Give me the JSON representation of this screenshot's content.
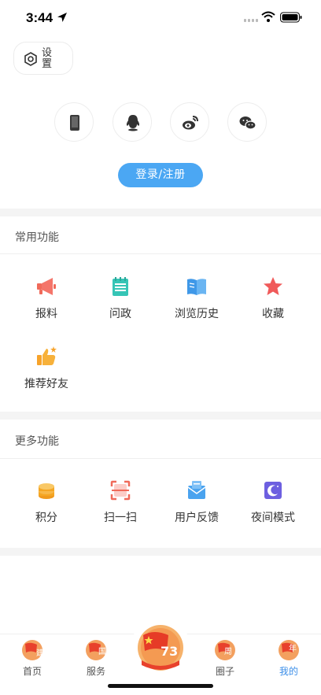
{
  "status_bar": {
    "time": "3:44"
  },
  "header": {
    "settings_label": "设置",
    "login_methods": [
      "phone",
      "qq",
      "weibo",
      "wechat"
    ],
    "login_button": "登录/注册"
  },
  "common_functions": {
    "title": "常用功能",
    "items": [
      {
        "label": "报料",
        "icon": "megaphone-icon"
      },
      {
        "label": "问政",
        "icon": "notepad-icon"
      },
      {
        "label": "浏览历史",
        "icon": "book-icon"
      },
      {
        "label": "收藏",
        "icon": "star-icon"
      },
      {
        "label": "推荐好友",
        "icon": "thumbs-up-icon"
      }
    ]
  },
  "more_functions": {
    "title": "更多功能",
    "items": [
      {
        "label": "积分",
        "icon": "coins-icon"
      },
      {
        "label": "扫一扫",
        "icon": "scan-icon"
      },
      {
        "label": "用户反馈",
        "icon": "feedback-icon"
      },
      {
        "label": "夜间模式",
        "icon": "moon-icon"
      }
    ]
  },
  "tab_bar": {
    "items": [
      {
        "label": "首页",
        "badge": "建"
      },
      {
        "label": "服务",
        "badge": "国"
      },
      {
        "label": "",
        "badge": "73"
      },
      {
        "label": "圈子",
        "badge": "周"
      },
      {
        "label": "我的",
        "badge": "年"
      }
    ],
    "active_color": "#3b8ee8"
  },
  "colors": {
    "accent": "#4ba7f3",
    "flag_red": "#e8412c"
  }
}
